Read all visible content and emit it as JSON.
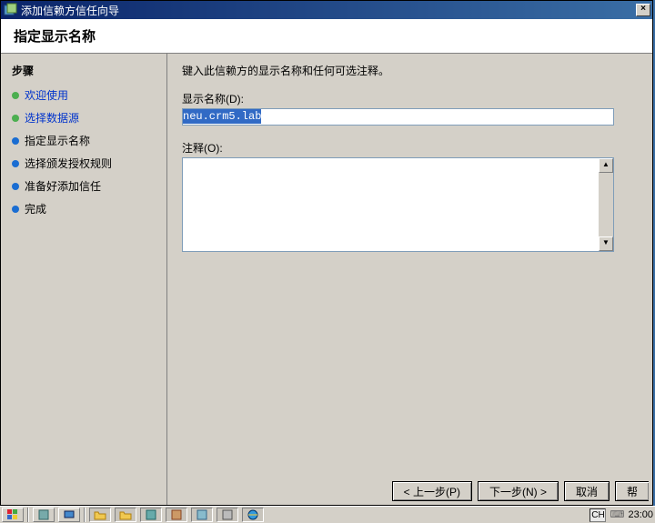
{
  "window": {
    "title": "添加信赖方信任向导",
    "close_symbol": "×"
  },
  "header": {
    "title": "指定显示名称"
  },
  "sidebar": {
    "title": "步骤",
    "steps": [
      {
        "label": "欢迎使用"
      },
      {
        "label": "选择数据源"
      },
      {
        "label": "指定显示名称"
      },
      {
        "label": "选择颁发授权规则"
      },
      {
        "label": "准备好添加信任"
      },
      {
        "label": "完成"
      }
    ]
  },
  "main": {
    "instruction": "键入此信赖方的显示名称和任何可选注释。",
    "display_name_label": "显示名称(D):",
    "display_name_value": "neu.crm5.lab",
    "notes_label": "注释(O):",
    "notes_value": ""
  },
  "buttons": {
    "prev": "< 上一步(P)",
    "next": "下一步(N) >",
    "cancel": "取消",
    "help": "帮"
  },
  "taskbar": {
    "lang": "CH",
    "clock": "23:00"
  }
}
